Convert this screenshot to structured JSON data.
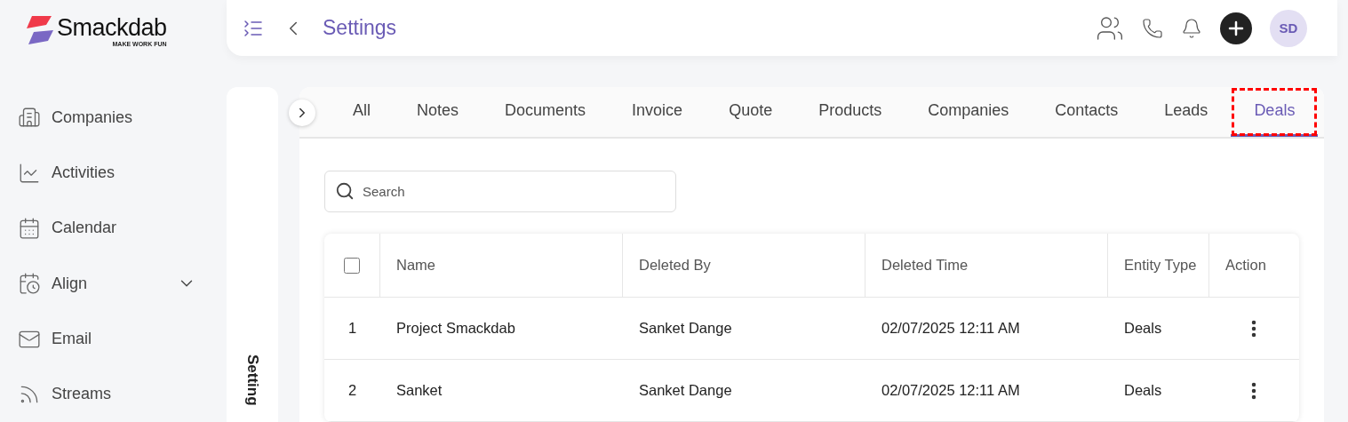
{
  "logo": {
    "name": "Smackdab",
    "tagline": "MAKE WORK FUN"
  },
  "header": {
    "title": "Settings",
    "avatar": "SD"
  },
  "sidebar": {
    "items": [
      {
        "label": "Companies",
        "expandable": false
      },
      {
        "label": "Activities",
        "expandable": false
      },
      {
        "label": "Calendar",
        "expandable": false
      },
      {
        "label": "Align",
        "expandable": true
      },
      {
        "label": "Email",
        "expandable": false
      },
      {
        "label": "Streams",
        "expandable": false
      }
    ]
  },
  "settings_panel": {
    "label": "Setting"
  },
  "tabs": [
    {
      "label": "All",
      "selected": false,
      "highlighted": false
    },
    {
      "label": "Notes",
      "selected": false,
      "highlighted": false
    },
    {
      "label": "Documents",
      "selected": false,
      "highlighted": false
    },
    {
      "label": "Invoice",
      "selected": false,
      "highlighted": false
    },
    {
      "label": "Quote",
      "selected": false,
      "highlighted": false
    },
    {
      "label": "Products",
      "selected": false,
      "highlighted": false
    },
    {
      "label": "Companies",
      "selected": false,
      "highlighted": false
    },
    {
      "label": "Contacts",
      "selected": false,
      "highlighted": false
    },
    {
      "label": "Leads",
      "selected": false,
      "highlighted": false
    },
    {
      "label": "Deals",
      "selected": true,
      "highlighted": true
    }
  ],
  "search": {
    "placeholder": "Search"
  },
  "table": {
    "select_all_checked": false,
    "columns": [
      "Name",
      "Deleted By",
      "Deleted Time",
      "Entity Type",
      "Action"
    ],
    "rows": [
      {
        "index": "1",
        "name": "Project Smackdab",
        "deleted_by": "Sanket Dange",
        "deleted_time": "02/07/2025 12:11 AM",
        "entity_type": "Deals"
      },
      {
        "index": "2",
        "name": "Sanket",
        "deleted_by": "Sanket Dange",
        "deleted_time": "02/07/2025 12:11 AM",
        "entity_type": "Deals"
      }
    ]
  }
}
